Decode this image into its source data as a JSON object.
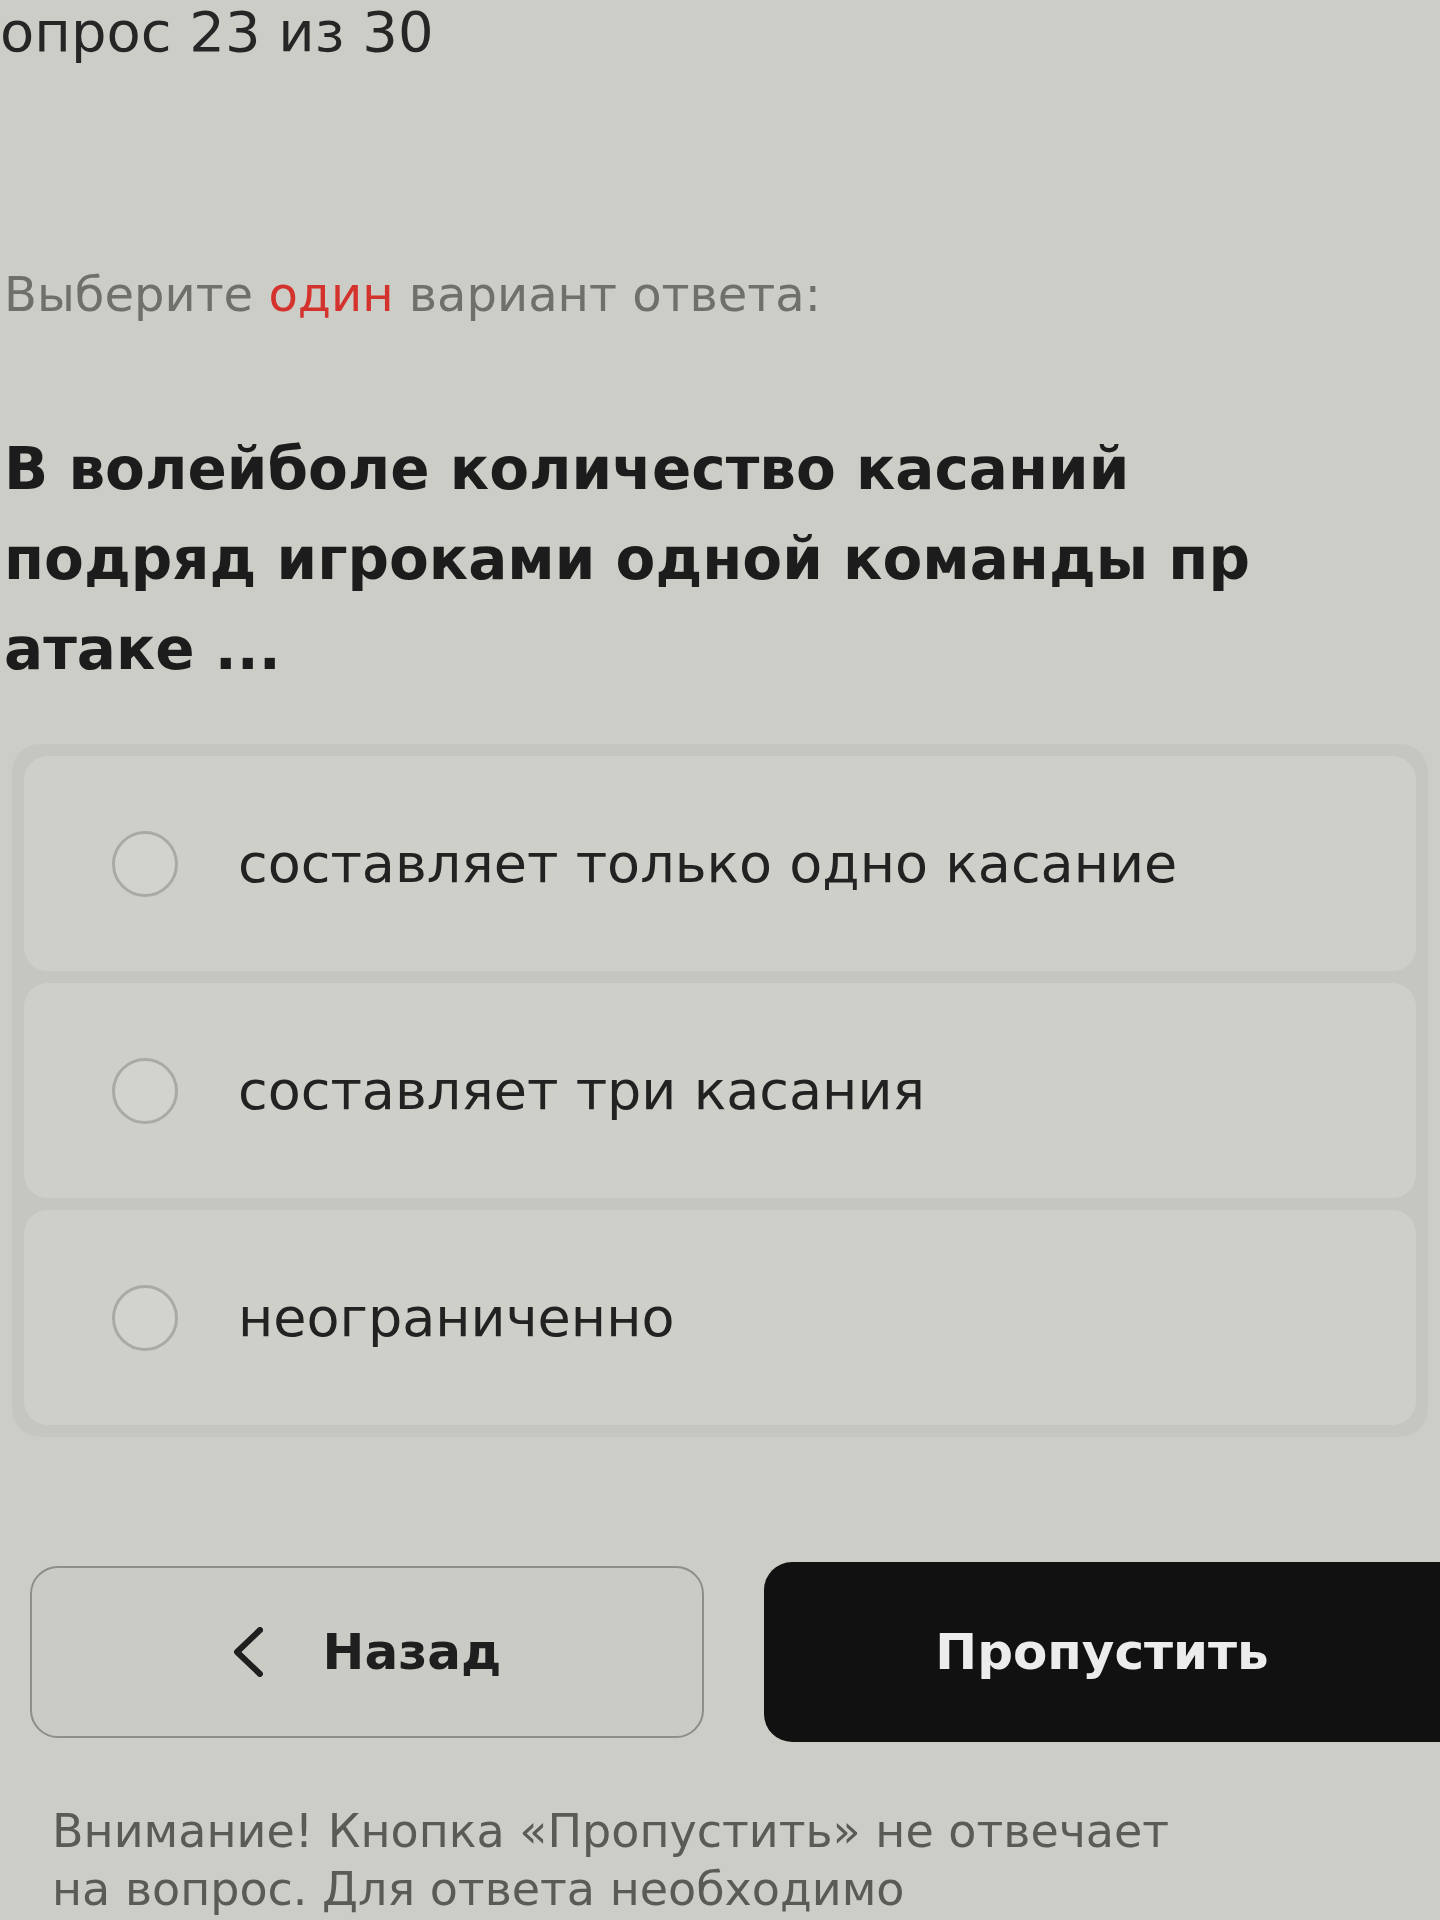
{
  "header": {
    "progress": "опрос 23 из 30"
  },
  "instruction": {
    "prefix": "Выберите",
    "emphasis": "один",
    "suffix": "вариант ответа:"
  },
  "question": {
    "lines": [
      "В волейболе количество касаний",
      "подряд игроками одной команды пр",
      "атаке ..."
    ]
  },
  "options": [
    {
      "label": "составляет только одно касание",
      "selected": false
    },
    {
      "label": "составляет три касания",
      "selected": false
    },
    {
      "label": "неограниченно",
      "selected": false
    }
  ],
  "buttons": [
    {
      "kind": "back",
      "label": "Назад"
    },
    {
      "kind": "skip",
      "label": "Пропустить"
    }
  ],
  "notice": {
    "lines": [
      "Внимание! Кнопка «Пропустить» не отвечает",
      "на вопрос. Для ответа необходимо"
    ]
  }
}
